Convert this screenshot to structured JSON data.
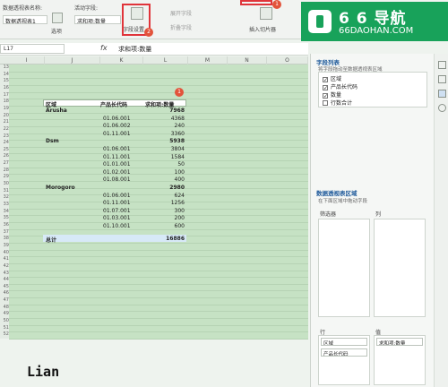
{
  "ribbon": {
    "pivot_name_label": "数据透视表名称:",
    "pivot_name_value": "数据透视表1",
    "options_label": "选项",
    "active_field_label": "活动字段:",
    "active_field_value": "求和项:数量",
    "field_settings_label": "字段设置",
    "expand_field_label": "展开字段",
    "collapse_field_label": "折叠字段",
    "insert_slicer_label": "插入切片器",
    "badge_1": "1",
    "badge_2": "2"
  },
  "logo": {
    "title": "6 6 导航",
    "url": "66DAOHAN.COM"
  },
  "formula": {
    "namebox": "L17",
    "fx": "fx",
    "value": "求和项:数量"
  },
  "columns": [
    "I",
    "J",
    "K",
    "L",
    "M",
    "N",
    "O"
  ],
  "row_numbers": [
    "13",
    "14",
    "15",
    "16",
    "17",
    "18",
    "19",
    "20",
    "21",
    "22",
    "23",
    "24",
    "25",
    "26",
    "27",
    "28",
    "29",
    "30",
    "31",
    "32",
    "33",
    "34",
    "35",
    "36",
    "37",
    "38",
    "39",
    "40",
    "41",
    "42",
    "43",
    "44",
    "45",
    "46",
    "47",
    "48",
    "49",
    "50",
    "51",
    "52"
  ],
  "pivot": {
    "header": {
      "region": "区域",
      "product": "产品长代码",
      "sum": "求和项:数量"
    },
    "rows": [
      {
        "region": "Arusha",
        "product": "",
        "value": "7968",
        "group": true
      },
      {
        "region": "",
        "product": "01.06.001",
        "value": "4368",
        "group": false
      },
      {
        "region": "",
        "product": "01.06.002",
        "value": "240",
        "group": false
      },
      {
        "region": "",
        "product": "01.11.001",
        "value": "3360",
        "group": false
      },
      {
        "region": "Dsm",
        "product": "",
        "value": "5938",
        "group": true
      },
      {
        "region": "",
        "product": "01.06.001",
        "value": "3804",
        "group": false
      },
      {
        "region": "",
        "product": "01.11.001",
        "value": "1584",
        "group": false
      },
      {
        "region": "",
        "product": "01.01.001",
        "value": "50",
        "group": false
      },
      {
        "region": "",
        "product": "01.02.001",
        "value": "100",
        "group": false
      },
      {
        "region": "",
        "product": "01.08.001",
        "value": "400",
        "group": false
      },
      {
        "region": "Morogoro",
        "product": "",
        "value": "2980",
        "group": true
      },
      {
        "region": "",
        "product": "01.06.001",
        "value": "624",
        "group": false
      },
      {
        "region": "",
        "product": "01.11.001",
        "value": "1256",
        "group": false
      },
      {
        "region": "",
        "product": "01.07.001",
        "value": "300",
        "group": false
      },
      {
        "region": "",
        "product": "01.03.001",
        "value": "200",
        "group": false
      },
      {
        "region": "",
        "product": "01.10.001",
        "value": "600",
        "group": false
      }
    ],
    "total_label": "总计",
    "total_value": "16886",
    "badge": "1"
  },
  "panel": {
    "field_list_title": "字段列表",
    "field_list_hint": "将字段拖动至数据透视表区域",
    "fields": [
      {
        "label": "区域",
        "checked": "✓"
      },
      {
        "label": "产品长代码",
        "checked": "✓"
      },
      {
        "label": "数量",
        "checked": "✓"
      },
      {
        "label": "行数合计",
        "checked": ""
      }
    ],
    "areas_title": "数据透视表区域",
    "areas_hint": "在下面区域中拖动字段",
    "filters_label": "筛选器",
    "columns_label": "列",
    "rows_label": "行",
    "values_label": "值",
    "row_items": [
      "区域",
      "产品长代码"
    ],
    "value_items": [
      "求和项:数量"
    ]
  },
  "signature": "Lian"
}
